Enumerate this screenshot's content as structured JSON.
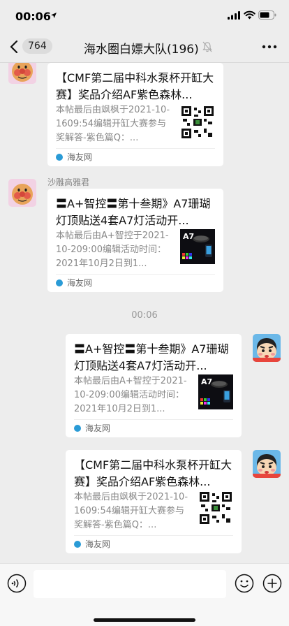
{
  "status_bar": {
    "time": "00:06"
  },
  "nav": {
    "unread_count": "764",
    "title": "海水圈白嫖大队(196)"
  },
  "messages": [
    {
      "side": "left",
      "sender": "",
      "title": "【CMF第二届中科水泵杯开缸大赛】奖品介绍AF紫色森林...",
      "desc": "本帖最后由飒枫于2021-10-1609:54编辑开缸大赛参与奖解答-紫色篇Q：...",
      "source": "海友网"
    },
    {
      "side": "left",
      "sender": "沙雕高雅君",
      "title": "〓A+智控〓第十叁期》A7珊瑚灯顶贴送4套A7灯活动开...",
      "desc": "本帖最后由A+智控于2021-10-209:00编辑活动时间：2021年10月2日到1...",
      "source": "海友网"
    },
    {
      "side": "right",
      "title": "〓A+智控〓第十叁期》A7珊瑚灯顶贴送4套A7灯活动开...",
      "desc": "本帖最后由A+智控于2021-10-209:00编辑活动时间：2021年10月2日到1...",
      "source": "海友网"
    },
    {
      "side": "right",
      "title": "【CMF第二届中科水泵杯开缸大赛】奖品介绍AF紫色森林...",
      "desc": "本帖最后由飒枫于2021-10-1609:54编辑开缸大赛参与奖解答-紫色篇Q：...",
      "source": "海友网"
    }
  ],
  "timestamp": "00:06",
  "thumb_label": "A7",
  "colors": {
    "background": "#ededed",
    "card": "#ffffff",
    "source_icon": "#2a9bd6"
  },
  "icons": [
    "location-arrow-icon",
    "signal-icon",
    "wifi-icon",
    "battery-icon",
    "back-chevron-icon",
    "mute-bell-icon",
    "more-icon",
    "voice-icon",
    "emoji-icon",
    "plus-icon"
  ]
}
